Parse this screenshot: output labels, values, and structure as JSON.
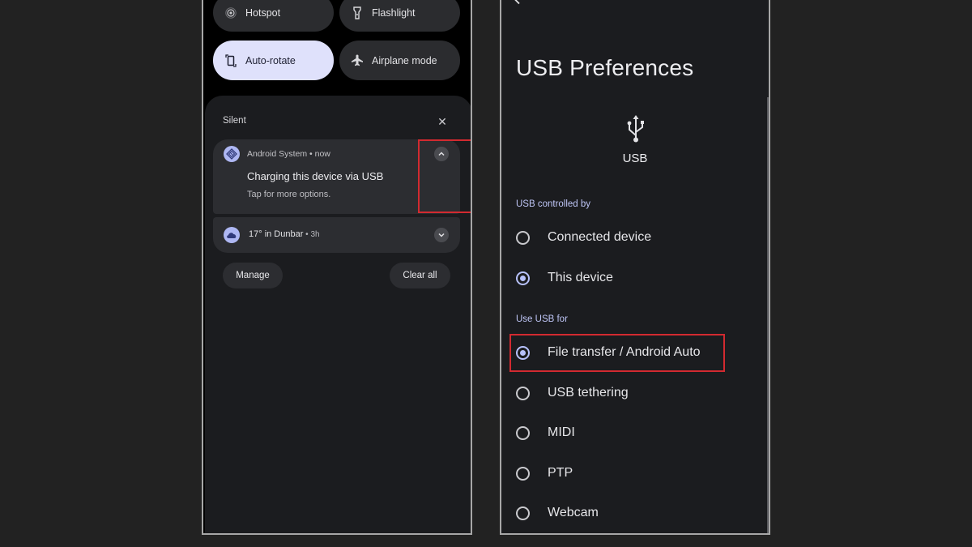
{
  "quick_settings": {
    "tiles": [
      {
        "label": "Hotspot",
        "icon": "hotspot-icon",
        "active": false
      },
      {
        "label": "Flashlight",
        "icon": "flashlight-icon",
        "active": false
      },
      {
        "label": "Auto-rotate",
        "icon": "auto-rotate-icon",
        "active": true
      },
      {
        "label": "Airplane mode",
        "icon": "airplane-icon",
        "active": false
      }
    ]
  },
  "notifications": {
    "section_label": "Silent",
    "items": [
      {
        "app": "Android System • now",
        "title": "Charging this device via USB",
        "text": "Tap for more options.",
        "icon": "android-system-icon",
        "expanded": true
      },
      {
        "app": "17° in Dunbar",
        "meta": " • 3h",
        "icon": "weather-cloud-icon",
        "expanded": false
      }
    ],
    "manage_label": "Manage",
    "clear_all_label": "Clear all"
  },
  "usb_preferences": {
    "title": "USB Preferences",
    "icon_label": "USB",
    "controlled_by_header": "USB controlled by",
    "controlled_by_options": [
      {
        "label": "Connected device",
        "selected": false
      },
      {
        "label": "This device",
        "selected": true
      }
    ],
    "use_for_header": "Use USB for",
    "use_for_options": [
      {
        "label": "File transfer / Android Auto",
        "selected": true
      },
      {
        "label": "USB tethering",
        "selected": false
      },
      {
        "label": "MIDI",
        "selected": false
      },
      {
        "label": "PTP",
        "selected": false
      },
      {
        "label": "Webcam",
        "selected": false
      }
    ]
  },
  "colors": {
    "highlight_box": "#d22a30",
    "accent": "#b7c1fb",
    "active_tile": "#dfe1fb"
  }
}
